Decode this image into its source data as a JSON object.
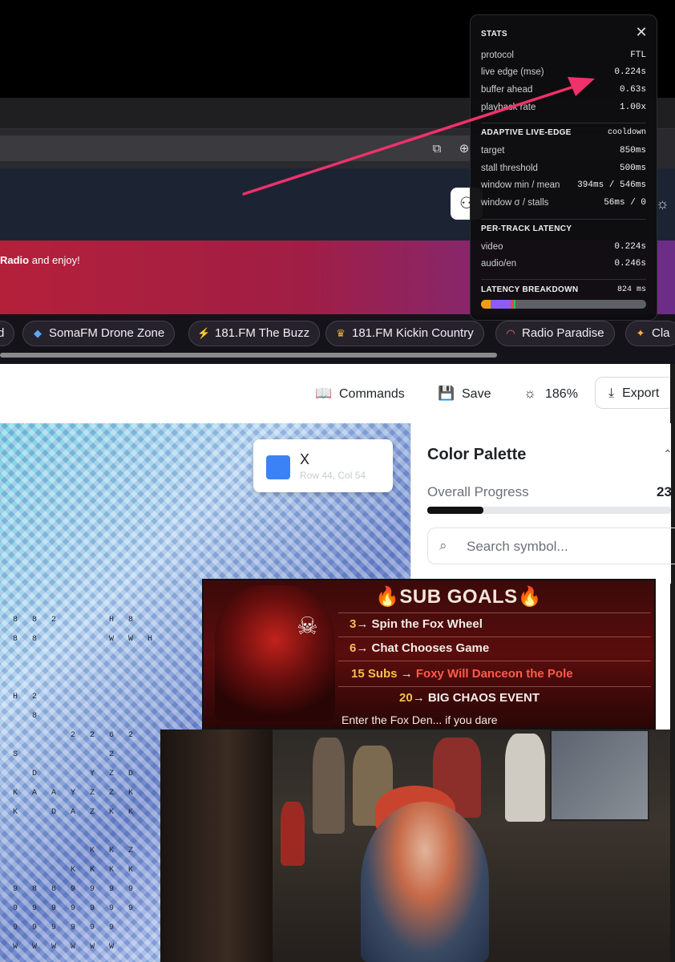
{
  "site": {
    "banner_bold": "Radio",
    "banner_rest": " and enjoy!"
  },
  "stations": [
    {
      "label": "d",
      "icon": ""
    },
    {
      "label": "SomaFM Drone Zone",
      "icon": "◆"
    },
    {
      "label": "181.FM The Buzz",
      "icon": "⚡"
    },
    {
      "label": "181.FM Kickin Country",
      "icon": "♛"
    },
    {
      "label": "Radio Paradise",
      "icon": "◠"
    },
    {
      "label": "Cla",
      "icon": "✦"
    }
  ],
  "toolbar": {
    "commands_label": "Commands",
    "save_label": "Save",
    "zoom_label": "186%",
    "export_label": "Export"
  },
  "tooltip": {
    "symbol": "X",
    "subtitle": "Row 44, Col 54",
    "swatch_color": "#3b82f6"
  },
  "palette": {
    "title": "Color Palette",
    "progress_label": "Overall Progress",
    "progress_value": "23",
    "progress_fraction": 0.23,
    "search_placeholder": "Search symbol..."
  },
  "sub_goals": {
    "title": "SUB GOALS",
    "goals": [
      {
        "count": "3",
        "text": "Spin the Fox Wheel"
      },
      {
        "count": "6",
        "text": "Chat Chooses Game"
      },
      {
        "count": "15 Subs",
        "text": "Foxy Will Danceon the Pole"
      },
      {
        "count": "20",
        "text": "BIG CHAOS EVENT"
      }
    ],
    "footer": "Enter the Fox Den... if you dare"
  },
  "stats": {
    "title": "STATS",
    "rows_top": [
      {
        "k": "protocol",
        "v": "FTL"
      },
      {
        "k": "live edge (mse)",
        "v": "0.224s"
      },
      {
        "k": "buffer ahead",
        "v": "0.63s"
      },
      {
        "k": "playback rate",
        "v": "1.00x"
      }
    ],
    "adaptive_title": "ADAPTIVE LIVE-EDGE",
    "adaptive_state": "cooldown",
    "rows_adaptive": [
      {
        "k": "target",
        "v": "850ms"
      },
      {
        "k": "stall threshold",
        "v": "500ms"
      },
      {
        "k": "window min / mean",
        "v": "394ms / 546ms"
      },
      {
        "k": "window σ / stalls",
        "v": "56ms / 0"
      }
    ],
    "per_track_title": "PER-TRACK LATENCY",
    "rows_track": [
      {
        "k": "video",
        "v": "0.224s"
      },
      {
        "k": "audio/en",
        "v": "0.246s"
      }
    ],
    "breakdown_title": "LATENCY BREAKDOWN",
    "breakdown_total": "824 ms",
    "breakdown_segments": [
      {
        "fraction": 0.06,
        "color": "#f59e0b"
      },
      {
        "fraction": 0.12,
        "color": "#8b5cf6"
      },
      {
        "fraction": 0.02,
        "color": "#ef4444"
      },
      {
        "fraction": 0.01,
        "color": "#22c55e"
      }
    ]
  }
}
